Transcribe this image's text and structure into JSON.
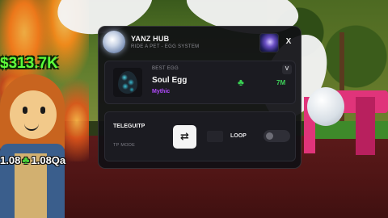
{
  "game": {
    "money": "$313.7K",
    "multiplier_left": "1.08",
    "multiplier_right": "1.08Qa",
    "clover_icon": "clover-icon"
  },
  "hub": {
    "title": "YANZ HUB",
    "subtitle": "RIDE A PET - EGG SYSTEM",
    "close_label": "X"
  },
  "best_egg": {
    "label": "BEST EGG",
    "name": "Soul Egg",
    "rarity": "Mythic",
    "rarity_color": "#b24bff",
    "value": "7M",
    "value_color": "#3ed35a",
    "dropdown_label": "V"
  },
  "teleport": {
    "title": "TELEGUITP",
    "mode_label": "TP MODE",
    "swap_icon": "⇄",
    "loop_label": "LOOP",
    "loop_enabled": false
  }
}
